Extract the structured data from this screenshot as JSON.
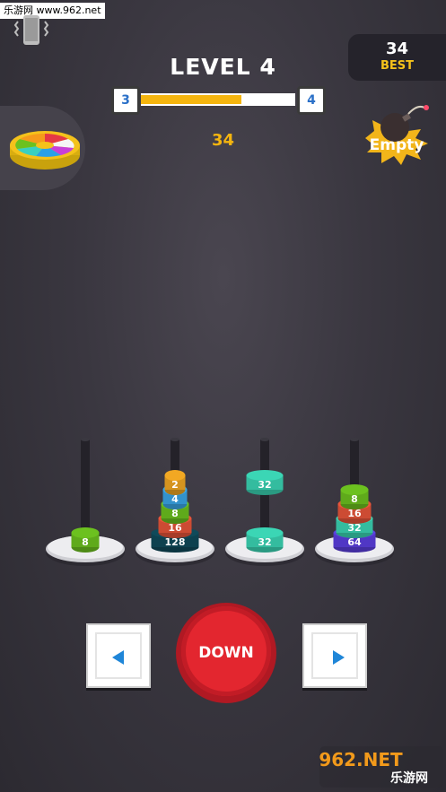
{
  "watermark_top": "乐游网 www.962.net",
  "best": {
    "value": "34",
    "label": "BEST"
  },
  "level": {
    "title": "LEVEL 4",
    "current": "3",
    "next": "4",
    "progress": 0.65
  },
  "score": "34",
  "bomb_label": "Empty",
  "pegs": [
    {
      "rings": [
        "8"
      ]
    },
    {
      "rings": [
        "128",
        "16",
        "8",
        "4",
        "2"
      ]
    },
    {
      "rings": [
        "32"
      ],
      "held": "32"
    },
    {
      "rings": [
        "64",
        "32",
        "16",
        "8"
      ]
    }
  ],
  "ring_colors": {
    "2": "#f2a823",
    "4": "#3aa6e8",
    "8": "#6cc11f",
    "16": "#e8553a",
    "32": "#3bd6b5",
    "64": "#5b3fe0",
    "128": "#0f4a5a"
  },
  "controls": {
    "down_label": "DOWN",
    "left_icon": "arrow-left-icon",
    "right_icon": "arrow-right-icon"
  },
  "watermark_br": {
    "brand": "962.NET",
    "sub": "乐游网"
  }
}
